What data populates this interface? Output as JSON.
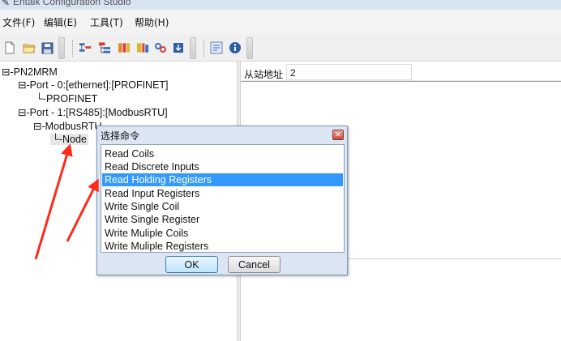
{
  "window": {
    "title": "Entalk Configuration Studio"
  },
  "menu": {
    "items": [
      {
        "label": "文件(F)"
      },
      {
        "label": "编辑(E)"
      },
      {
        "label": "工具(T)"
      },
      {
        "label": "帮助(H)"
      }
    ]
  },
  "toolbar": {
    "buttons": [
      {
        "icon": "new-file-icon"
      },
      {
        "icon": "open-folder-icon"
      },
      {
        "icon": "save-icon"
      },
      {
        "icon": "add-port-icon"
      },
      {
        "icon": "add-device-icon"
      },
      {
        "icon": "add-command-icon"
      },
      {
        "icon": "add-data-icon"
      },
      {
        "icon": "link-icon"
      },
      {
        "icon": "download-icon"
      },
      {
        "icon": "settings-icon"
      },
      {
        "icon": "info-icon"
      }
    ]
  },
  "tree": {
    "nodes": [
      {
        "prefix": "⊟-",
        "label": "PN2MRM"
      },
      {
        "prefix": "⊟-",
        "label": "Port - 0:[ethernet]:[PROFINET]"
      },
      {
        "prefix": "└-",
        "label": "PROFINET"
      },
      {
        "prefix": "⊟-",
        "label": "Port - 1:[RS485]:[ModbusRTU]"
      },
      {
        "prefix": "⊟-",
        "label": "ModbusRTU"
      },
      {
        "prefix": "└-",
        "label": "Node"
      }
    ]
  },
  "properties": {
    "rows": [
      {
        "label": "从站地址",
        "value": "2"
      }
    ]
  },
  "dialog": {
    "title": "选择命令",
    "close_icon": "close-icon",
    "options": [
      "Read Coils",
      "Read Discrete Inputs",
      "Read Holding Registers",
      "Read Input Registers",
      "Write Single Coil",
      "Write Single Register",
      "Write Muliple Coils",
      "Write Muliple Registers"
    ],
    "selected_option": "Read Holding Registers",
    "ok_label": "OK",
    "cancel_label": "Cancel"
  },
  "colors": {
    "selection": "#3399ff",
    "annotation_arrow": "#ff2a1a",
    "dialog_background": "#dce6f3"
  }
}
